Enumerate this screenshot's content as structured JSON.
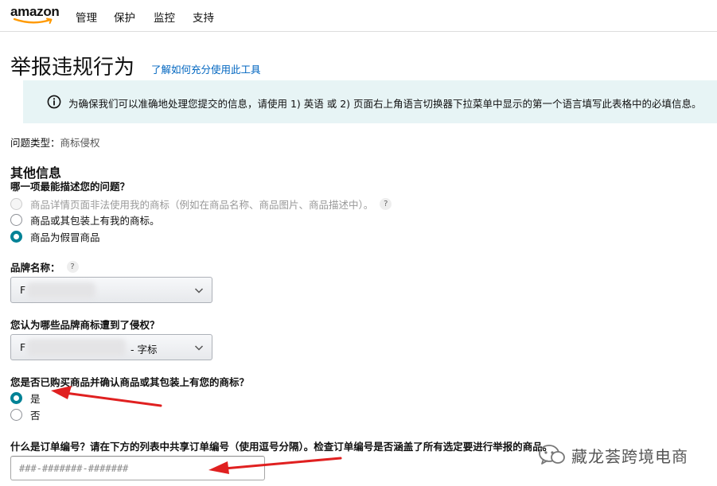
{
  "brand": {
    "logo_text": "amazon"
  },
  "nav": {
    "items": [
      {
        "label": "管理"
      },
      {
        "label": "保护"
      },
      {
        "label": "监控"
      },
      {
        "label": "支持"
      }
    ]
  },
  "page": {
    "title": "举报违规行为",
    "help_link": "了解如何充分使用此工具"
  },
  "info": {
    "text": "为确保我们可以准确地处理您提交的信息，请使用 1) 英语 或 2) 页面右上角语言切换器下拉菜单中显示的第一个语言填写此表格中的必填信息。"
  },
  "issue_type": {
    "label": "问题类型：",
    "value": "商标侵权"
  },
  "other_info": {
    "heading": "其他信息",
    "question": "哪一项最能描述您的问题？",
    "options": [
      {
        "label": "商品详情页面非法使用我的商标（例如在商品名称、商品图片、商品描述中）。",
        "state": "disabled",
        "help": "?"
      },
      {
        "label": "商品或其包装上有我的商标。",
        "state": "unchecked"
      },
      {
        "label": "商品为假冒商品",
        "state": "checked"
      }
    ]
  },
  "brand_name": {
    "label": "品牌名称：",
    "help": "?",
    "value": "F"
  },
  "trademark": {
    "label": "您认为哪些品牌商标遭到了侵权？",
    "value_prefix": "F",
    "value_suffix": "- 字标"
  },
  "purchase": {
    "question": "您是否已购买商品并确认商品或其包装上有您的商标？",
    "options": [
      {
        "label": "是",
        "state": "checked"
      },
      {
        "label": "否",
        "state": "unchecked"
      }
    ]
  },
  "order": {
    "label": "什么是订单编号？请在下方的列表中共享订单编号（使用逗号分隔）。检查订单编号是否涵盖了所有选定要进行举报的商品。",
    "placeholder": "###-#######-#######"
  },
  "watermark": {
    "text": "藏龙荟跨境电商"
  },
  "colors": {
    "accent_teal": "#008296",
    "link_blue": "#0066c0",
    "info_bg": "#e7f4f5",
    "annotation_red": "#e02020"
  },
  "icons": {
    "info": "info-circle-icon",
    "chevron": "chevron-down-icon",
    "watermark": "wechat-icon"
  }
}
